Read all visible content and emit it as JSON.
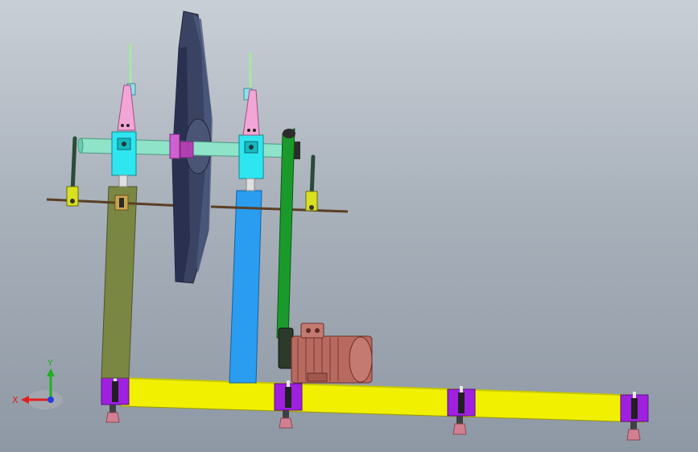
{
  "viewport": {
    "background_top": "#c9cfd6",
    "background_bottom": "#8e98a4"
  },
  "triad": {
    "x_label": "X",
    "y_label": "Y",
    "x_color": "#e02020",
    "y_color": "#20b020",
    "z_color": "#2040e0"
  },
  "parts": {
    "flywheel_color": "#3a4462",
    "shaft_color": "#8fe3c8",
    "bearing_color": "#2ee6f0",
    "load_cell_color": "#f3a6d6",
    "left_column_color": "#7a8743",
    "right_column_color": "#2a9df0",
    "base_beam_color": "#f0f000",
    "foot_block_color": "#a020e0",
    "leveling_foot_color": "#d08090",
    "belt_color": "#1a9a2a",
    "motor_color": "#b86a60",
    "clamp_rod_color": "#5a3e24",
    "clamp_block_color": "#d8e020",
    "lever_color": "#2a4a3a"
  }
}
